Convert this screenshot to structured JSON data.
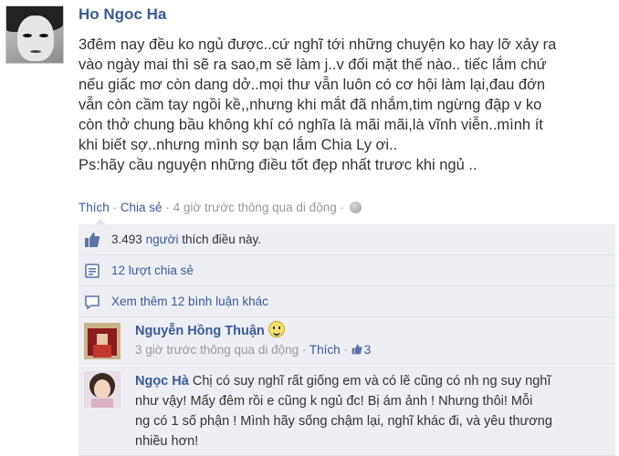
{
  "post": {
    "author": "Ho Ngoc Ha",
    "body_lines": [
      "3đêm nay đều ko ngủ được..cứ nghĩ tới những chuyện ko hay lỡ xảy ra",
      "vào ngày mai thì sẽ ra sao,m sẽ làm j..v đối mặt thế nào.. tiếc lắm chứ",
      "nếu giấc mơ còn dang dở..mọi thư vẫn luôn có cơ hội làm lại,đau đớn",
      "vẫn còn cầm tay ngồi kề,,nhưng khi mắt đã nhắm,tim ngừng đập v ko",
      "còn thở chung bầu không khí có nghĩa là mãi mãi,là vĩnh viễn..mình ít",
      "khi biết sợ..nhưng mình sợ bạn lắm Chia Ly ơi..",
      "Ps:hãy cầu nguyện những điều tốt đẹp nhất trươc khi ngủ .."
    ],
    "like_link": "Thích",
    "share_link": "Chia sẻ",
    "sep": "·",
    "meta": "4 giờ trước thông qua di động",
    "globe_icon": "globe-icon"
  },
  "ufi": {
    "likes_count": "3.493",
    "likes_suffix": "thích điều này.",
    "likes_prefix": "người",
    "shares": "12 lượt chia sẻ",
    "more_comments": "Xem thêm 12 bình luận khác",
    "bg_color": "#edeff4",
    "link_color": "#3b5998"
  },
  "comments": [
    {
      "name": "Nguyễn Hồng Thuận",
      "emoji": "smiley-icon",
      "meta": "3 giờ trước thông qua di động",
      "like_link": "Thích",
      "like_count": "3"
    },
    {
      "name": "Ngọc Hà",
      "text_lines": [
        "Chị có suy nghĩ rất giống em và có lẽ cũng có nh ng suy nghĩ",
        "như vậy! Mấy đêm rồi e cũng k ngủ đc! Bị ám ảnh ! Nhưng thôi! Mỗi",
        "ng có 1 số phận ! Mình hãy sống chậm lại, nghĩ khác đi, và yêu thương",
        "nhiều hơn!"
      ]
    }
  ]
}
